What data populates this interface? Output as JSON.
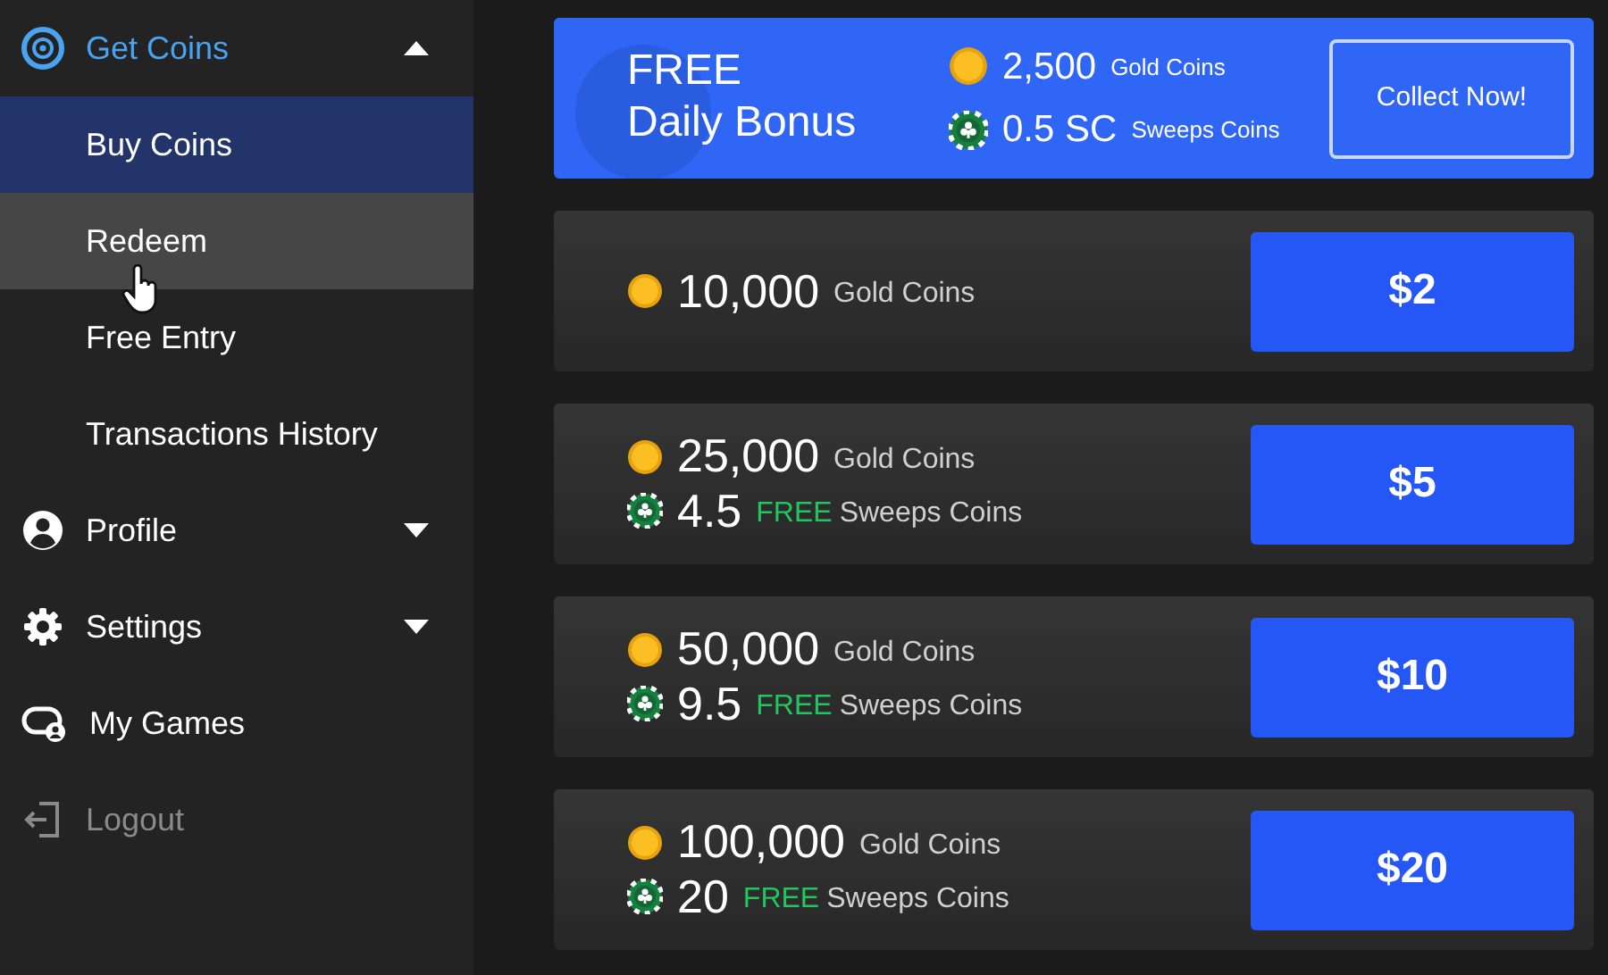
{
  "sidebar": {
    "items": [
      {
        "label": "Get Coins",
        "kind": "coins",
        "expanded": true,
        "selected": true,
        "disabled": false,
        "children": [
          {
            "label": "Buy Coins",
            "selected": true,
            "hovered": false
          },
          {
            "label": "Redeem",
            "selected": false,
            "hovered": true
          },
          {
            "label": "Free Entry",
            "selected": false,
            "hovered": false
          },
          {
            "label": "Transactions History",
            "selected": false,
            "hovered": false
          }
        ]
      },
      {
        "label": "Profile",
        "kind": "user",
        "expanded": false,
        "selected": false,
        "disabled": false
      },
      {
        "label": "Settings",
        "kind": "gear",
        "expanded": false,
        "selected": false,
        "disabled": false
      },
      {
        "label": "My Games",
        "kind": "games",
        "selected": false,
        "disabled": false
      },
      {
        "label": "Logout",
        "kind": "logout",
        "selected": false,
        "disabled": true
      }
    ]
  },
  "daily_bonus": {
    "title_line_1": "FREE",
    "title_line_2": "Daily Bonus",
    "gold_amount": "2,500",
    "gold_label": "Gold Coins",
    "sweeps_amount": "0.5 SC",
    "sweeps_label": "Sweeps Coins",
    "button": "Collect Now!"
  },
  "packages": [
    {
      "gold_amount": "10,000",
      "gold_label": "Gold Coins",
      "price": "$2"
    },
    {
      "gold_amount": "25,000",
      "gold_label": "Gold Coins",
      "sweeps_amount": "4.5",
      "sweeps_free": "FREE",
      "sweeps_label": "Sweeps Coins",
      "price": "$5"
    },
    {
      "gold_amount": "50,000",
      "gold_label": "Gold Coins",
      "sweeps_amount": "9.5",
      "sweeps_free": "FREE",
      "sweeps_label": "Sweeps Coins",
      "price": "$10"
    },
    {
      "gold_amount": "100,000",
      "gold_label": "Gold Coins",
      "sweeps_amount": "20",
      "sweeps_free": "FREE",
      "sweeps_label": "Sweeps Coins",
      "price": "$20"
    }
  ]
}
